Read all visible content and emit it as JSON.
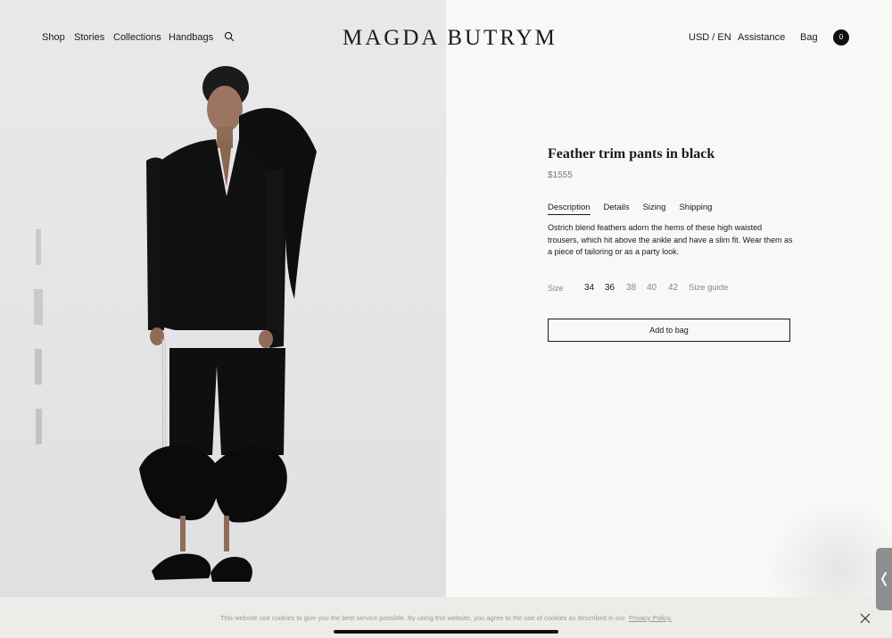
{
  "header": {
    "nav": [
      "Shop",
      "Stories",
      "Collections",
      "Handbags"
    ],
    "logo": "MAGDA BUTRYM",
    "currency": "USD / EN",
    "assistance": "Assistance",
    "bag": "Bag",
    "bag_count": "0"
  },
  "product": {
    "title": "Feather trim pants in black",
    "price": "$1555",
    "tabs": [
      "Description",
      "Details",
      "Sizing",
      "Shipping"
    ],
    "active_tab": "Description",
    "description": "Ostrich blend feathers adorn the hems of these high waisted trousers, which hit above the ankle and have a slim fit. Wear them as a piece of tailoring or as a party look.",
    "size_label": "Size",
    "sizes": [
      {
        "label": "34",
        "available": true
      },
      {
        "label": "36",
        "available": true
      },
      {
        "label": "38",
        "available": false
      },
      {
        "label": "40",
        "available": false
      },
      {
        "label": "42",
        "available": false
      }
    ],
    "size_guide": "Size guide",
    "add_to_bag": "Add to bag"
  },
  "cookie": {
    "text": "This website use cookies to give you the best service possible. By using this website, you agree to the use of cookies as described in our",
    "link": "Privacy Policy."
  },
  "icons": {
    "search": "search-icon",
    "close": "close-icon",
    "handle": "chevron-left-icon"
  },
  "colors": {
    "text": "#1a1a1a",
    "muted": "#888888",
    "background": "#f9f8f6",
    "image_background": "#e6e6e8",
    "cookie_bar": "#eeece8"
  }
}
